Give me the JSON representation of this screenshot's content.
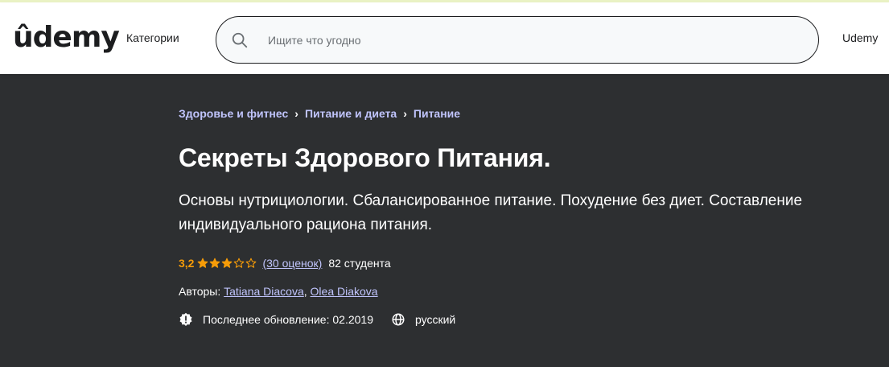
{
  "header": {
    "logo_text": "ûdemy",
    "categories_label": "Категории",
    "search": {
      "placeholder": "Ищите что угодно",
      "value": ""
    },
    "business_label": "Udemy"
  },
  "course": {
    "breadcrumb": [
      "Здоровье и фитнес",
      "Питание и диета",
      "Питание"
    ],
    "breadcrumb_separator": "›",
    "title": "Секреты Здорового Питания.",
    "subtitle": "Основы нутрициологии. Сбалансированное питание. Похудение без диет. Составление индивидуального рациона питания.",
    "rating": {
      "value": "3,2",
      "stars": 3.2,
      "count_label": "(30 оценок)",
      "students": "82 студента"
    },
    "authors": {
      "label": "Авторы:",
      "names": [
        "Tatiana Diacova",
        "Olea Diakova"
      ],
      "separator": ","
    },
    "last_updated": "Последнее обновление: 02.2019",
    "language": "русский"
  },
  "colors": {
    "accent_purple": "#a435f0",
    "link_lavender": "#c0c4fc",
    "star_orange": "#f69c08",
    "hero_bg": "#2d2f31"
  }
}
